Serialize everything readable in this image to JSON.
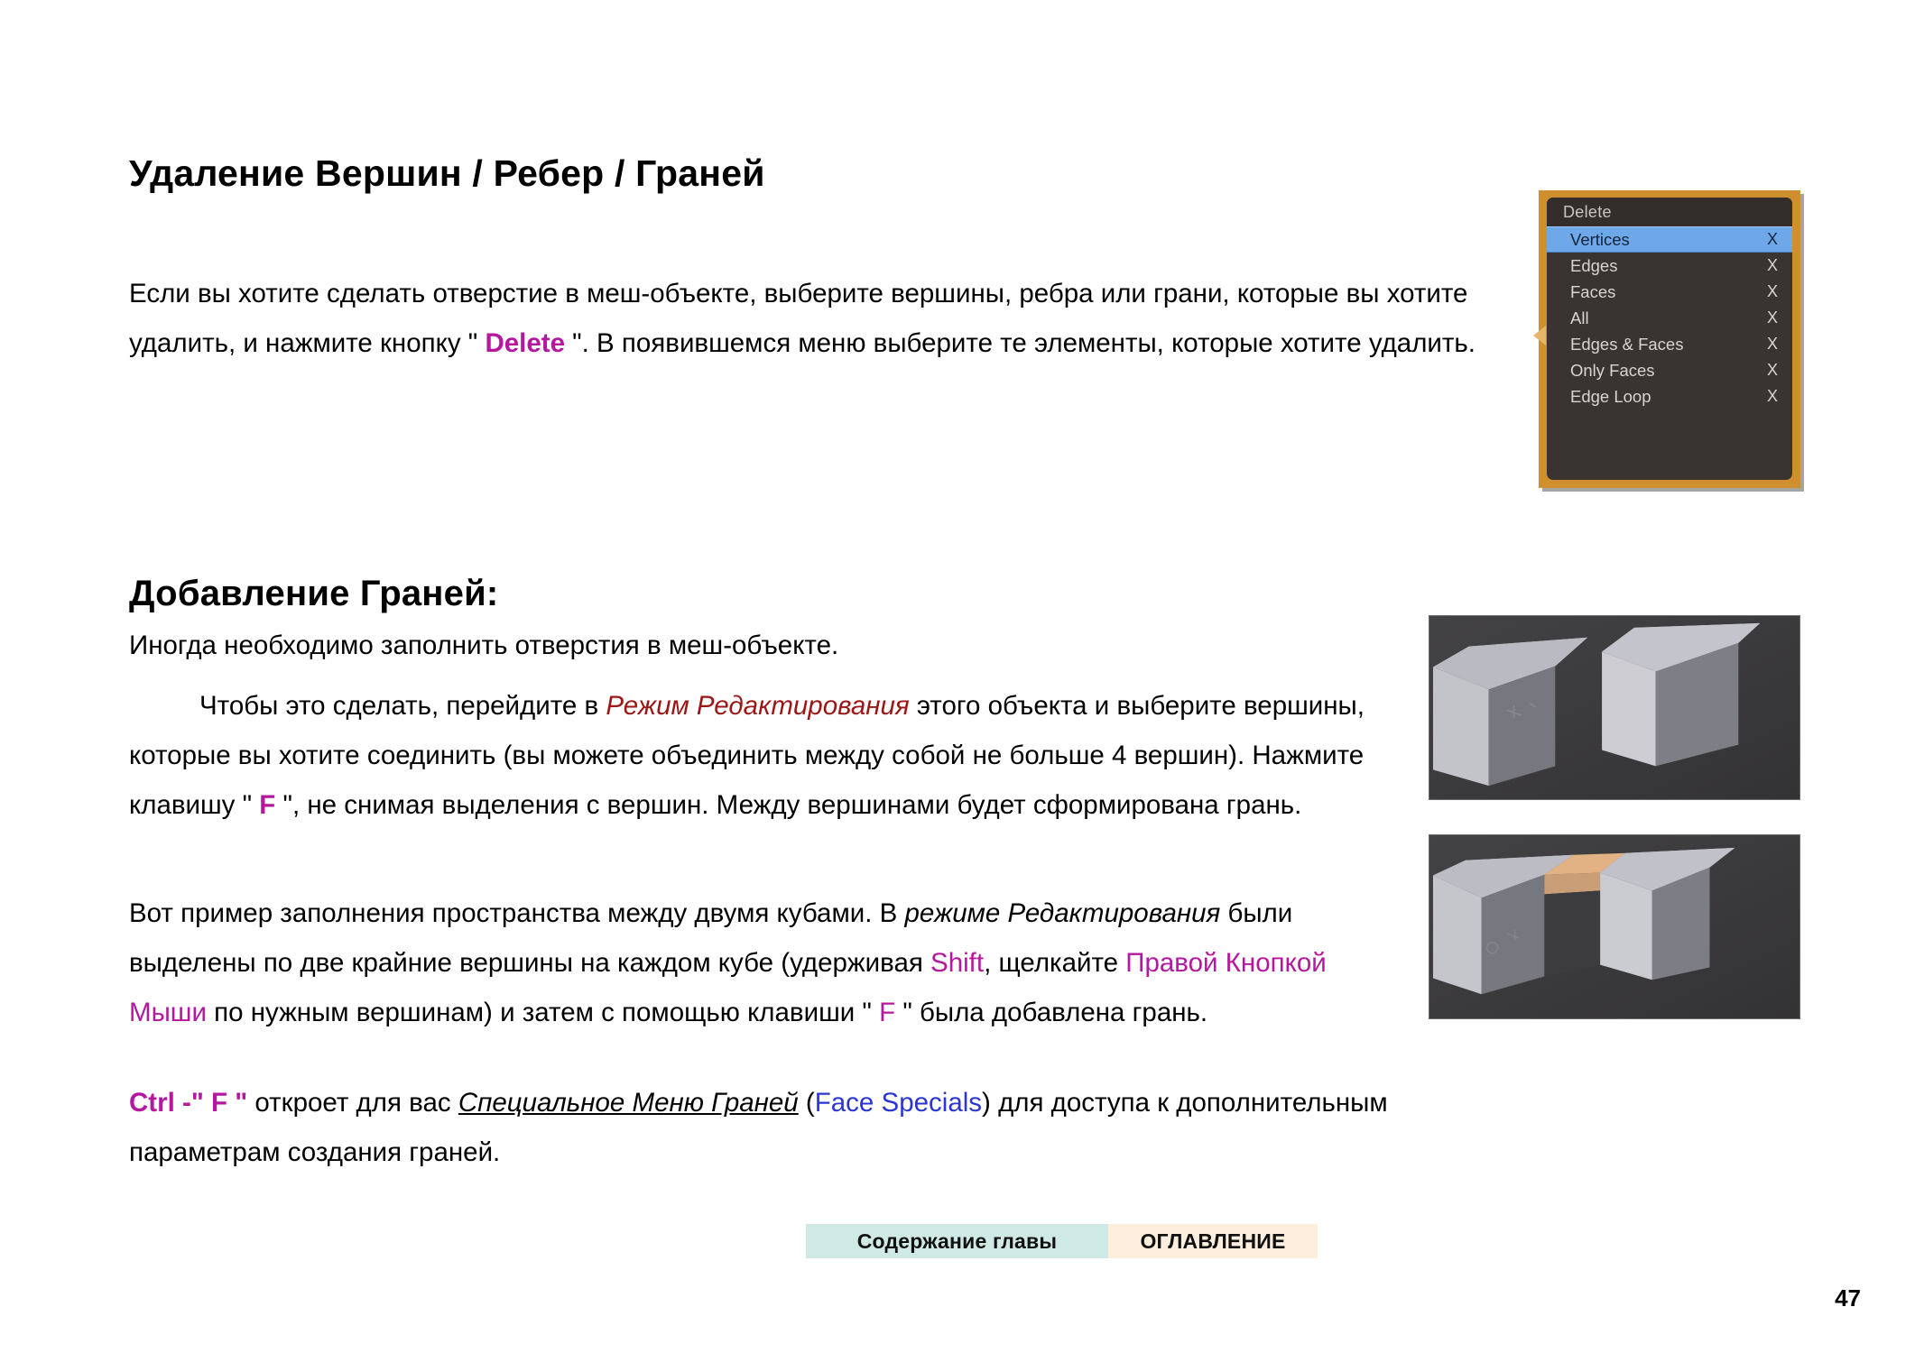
{
  "page": {
    "number": "47",
    "background": "#ffffff"
  },
  "sections": {
    "delete": {
      "heading": "Удаление Вершин / Ребер / Граней",
      "paragraph": {
        "part1": "Если вы хотите сделать отверстие в меш-объекте, выберите вершины, ребра или грани, которые вы хотите удалить, и нажмите кнопку \" ",
        "highlight1": "Delete",
        "part2": " \". В появившемся меню выберите те элементы, которые хотите удалить."
      }
    },
    "add_faces": {
      "heading": "Добавление Граней:",
      "intro": "Иногда необходимо заполнить отверстия в меш-объекте.",
      "howto": {
        "part1": "Чтобы это сделать, перейдите в ",
        "emphasis1": "Режим Редактирования",
        "part2": " этого объекта и выберите вершины, которые вы хотите соединить (вы можете объединить между собой не больше 4 вершин). Нажмите клавишу \" ",
        "key1": "F",
        "part3": " \", не снимая выделения с вершин. Между вершинами будет сформирована грань."
      },
      "example": {
        "part1": "Вот пример заполнения пространства между двумя кубами. В ",
        "emphasis1": "режиме Редактирования",
        "part2": " были выделены по две крайние вершины на каждом кубе (удерживая ",
        "key1": "Shift",
        "part3": ", щелкайте ",
        "key2": "Правой Кнопкой Мыши",
        "part4": " по нужным вершинам) и затем с помощью клавиши \" ",
        "key3": "F",
        "part5": " \" была добавлена грань."
      },
      "ctrl_f": {
        "shortcut": "Ctrl -\" F \"",
        "part1": " откроет для вас ",
        "emphasis1": "Специальное Меню Граней",
        "part2": " (",
        "link1": "Face Specials",
        "part3": ") для доступа к дополнительным параметрам создания граней."
      }
    }
  },
  "delete_menu": {
    "title": "Delete",
    "border_color": "#d08f2e",
    "selected_color": "#6fa8e8",
    "items": [
      {
        "label": "Vertices",
        "key": "X",
        "selected": true
      },
      {
        "label": "Edges",
        "key": "X",
        "selected": false
      },
      {
        "label": "Faces",
        "key": "X",
        "selected": false
      },
      {
        "label": "All",
        "key": "X",
        "selected": false
      },
      {
        "label": "Edges & Faces",
        "key": "X",
        "selected": false
      },
      {
        "label": "Only Faces",
        "key": "X",
        "selected": false
      },
      {
        "label": "Edge Loop",
        "key": "X",
        "selected": false
      }
    ]
  },
  "screenshots": {
    "two_cubes": {
      "caption_role": "two separate cubes in edit mode",
      "background": "#3b3b3d"
    },
    "bridged_cubes": {
      "caption_role": "two cubes joined by a new face",
      "background": "#3b3b3d",
      "new_face_color": "#e2b184"
    }
  },
  "footer": {
    "chapter_contents_label": "Содержание главы",
    "toc_label": "ОГЛАВЛЕНИЕ",
    "chapter_contents_color": "#cfe9e4",
    "toc_color": "#fdeedd"
  }
}
